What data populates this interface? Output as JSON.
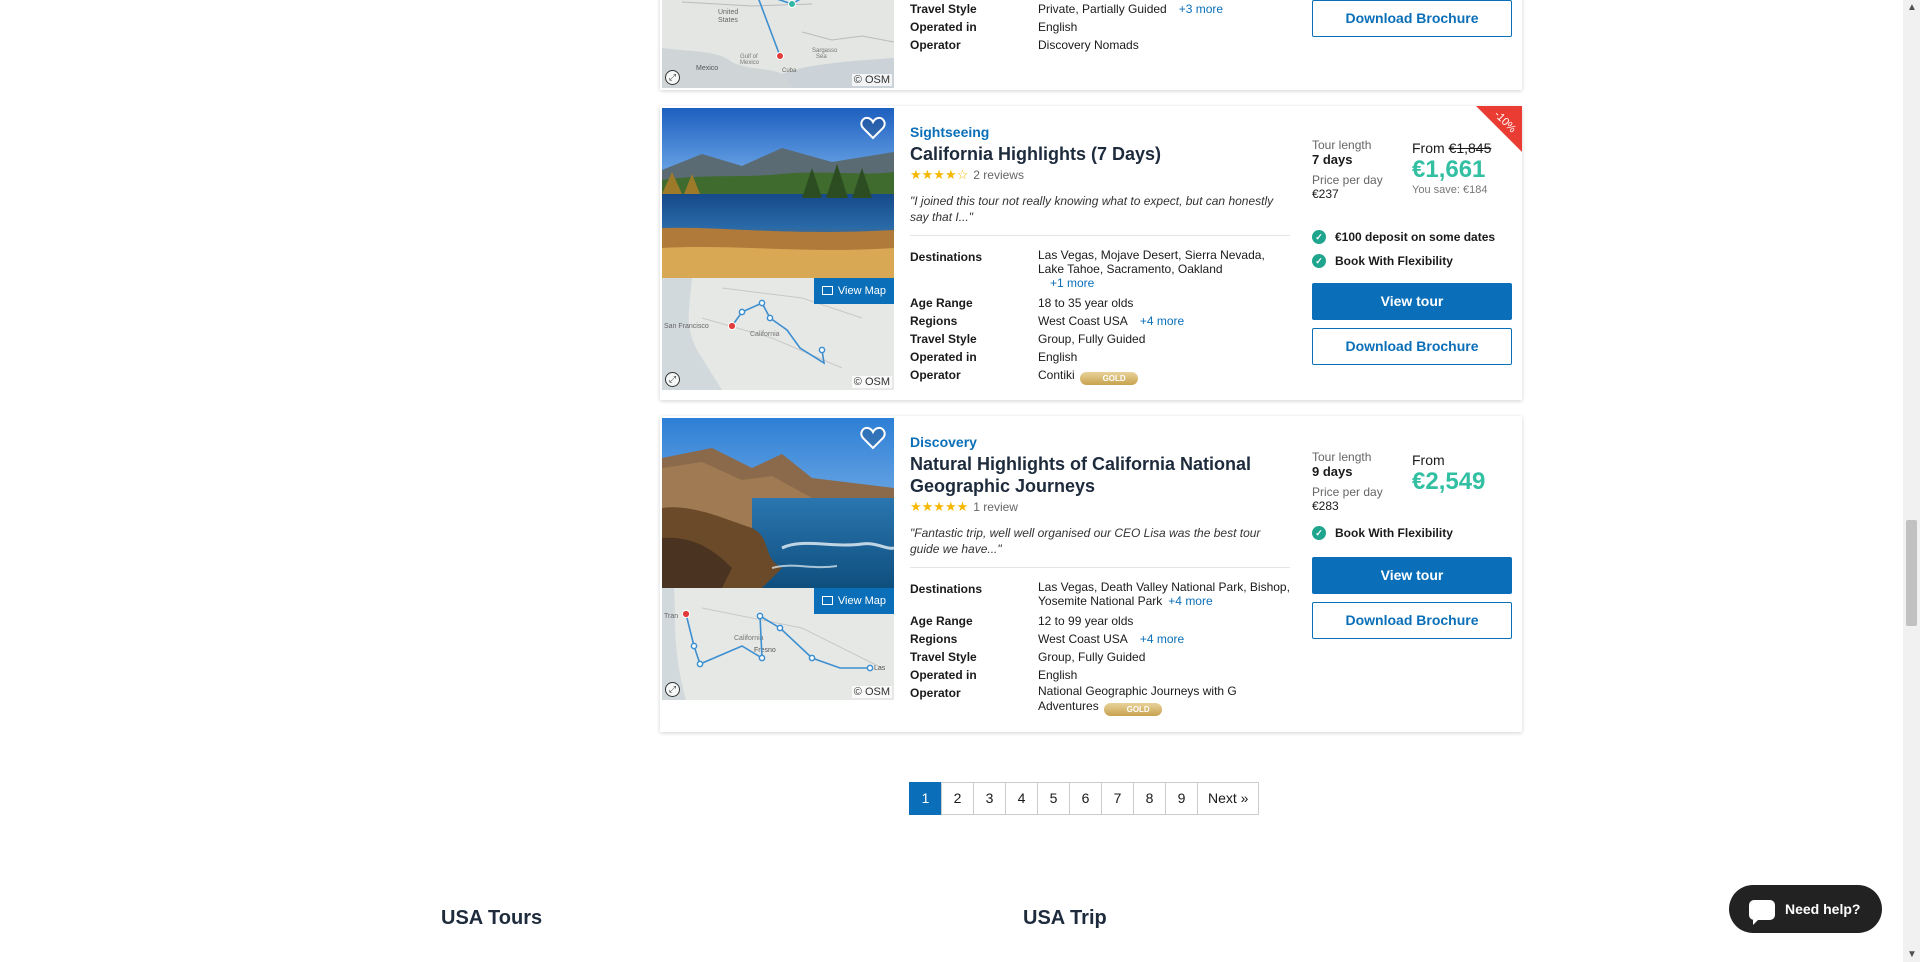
{
  "card0": {
    "osm": "© OSM",
    "rows": [
      {
        "k": "Travel Style",
        "v": "Private, Partially Guided",
        "more": "+3 more"
      },
      {
        "k": "Operated in",
        "v": "English"
      },
      {
        "k": "Operator",
        "v": "Discovery Nomads"
      }
    ],
    "brochure": "Download Brochure"
  },
  "card1": {
    "style": "Sightseeing",
    "title": "California Highlights (7 Days)",
    "rating": 4,
    "reviews": "2 reviews",
    "quote": "\"I joined this tour not really knowing what to expect, but can honestly say that I...\"",
    "destinations": "Las Vegas, Mojave Desert, Sierra Nevada, Lake Tahoe, Sacramento, Oakland",
    "destinations_more": "+1 more",
    "age": "18 to 35 year olds",
    "regions": "West Coast USA",
    "regions_more": "+4 more",
    "travel_style": "Group, Fully Guided",
    "operated_in": "English",
    "operator": "Contiki",
    "operator_badge": "GOLD",
    "tour_length_label": "Tour length",
    "tour_length": "7 days",
    "ppd_label": "Price per day",
    "ppd": "€237",
    "from": "From",
    "old_price": "€1,845",
    "price": "€1,661",
    "save": "You save: €184",
    "discount": "-10%",
    "check1": "€100 deposit on some dates",
    "check2": "Book With Flexibility",
    "view": "View tour",
    "brochure": "Download Brochure",
    "view_map": "View Map",
    "osm": "© OSM"
  },
  "card2": {
    "style": "Discovery",
    "title": "Natural Highlights of California National Geographic Journeys",
    "rating": 5,
    "reviews": "1 review",
    "quote": "\"Fantastic trip, well well organised our CEO Lisa was the best tour guide we have...\"",
    "destinations": "Las Vegas, Death Valley National Park, Bishop, Yosemite National Park",
    "destinations_more": "+4 more",
    "age": "12 to 99 year olds",
    "regions": "West Coast USA",
    "regions_more": "+4 more",
    "travel_style": "Group, Fully Guided",
    "operated_in": "English",
    "operator": "National Geographic Journeys with G Adventures",
    "operator_badge": "GOLD",
    "tour_length_label": "Tour length",
    "tour_length": "9 days",
    "ppd_label": "Price per day",
    "ppd": "€283",
    "from": "From",
    "price": "€2,549",
    "check1": "Book With Flexibility",
    "view": "View tour",
    "brochure": "Download Brochure",
    "view_map": "View Map",
    "osm": "© OSM"
  },
  "labels": {
    "destinations": "Destinations",
    "age": "Age Range",
    "regions": "Regions",
    "travel_style": "Travel Style",
    "operated_in": "Operated in",
    "operator": "Operator"
  },
  "pagination": {
    "pages": [
      "1",
      "2",
      "3",
      "4",
      "5",
      "6",
      "7",
      "8",
      "9"
    ],
    "current": "1",
    "next": "Next »"
  },
  "footer": {
    "col1": "USA Tours",
    "col2": "USA Trip"
  },
  "help": "Need help?",
  "colors": {
    "brand": "#0a6fb8",
    "price": "#32bfa2",
    "check": "#1fa58d",
    "discount": "#ea3c32"
  }
}
